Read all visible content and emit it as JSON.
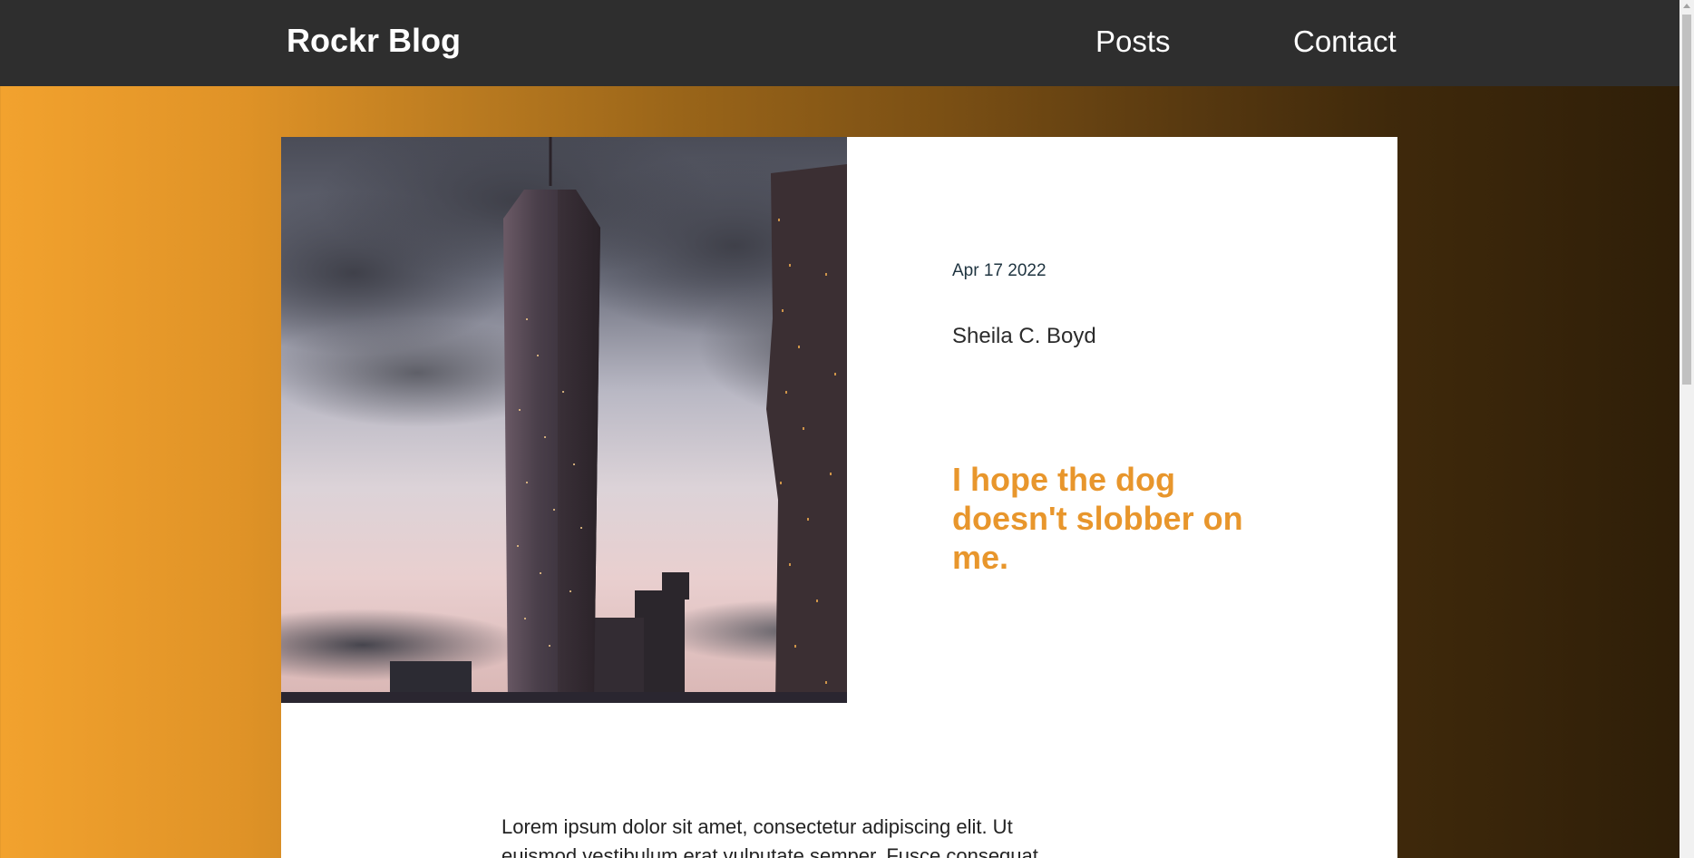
{
  "nav": {
    "brand": "Rockr Blog",
    "links": [
      "Posts",
      "Contact"
    ]
  },
  "post": {
    "image_alt": "skyscraper-at-dusk-photo",
    "date": "Apr 17 2022",
    "author": "Sheila C. Boyd",
    "title": "I hope the dog doesn't slobber on me.",
    "body": "Lorem ipsum dolor sit amet, consectetur adipiscing elit. Ut euismod vestibulum erat vulputate semper. Fusce consequat"
  },
  "colors": {
    "navbar_bg": "#2e2e2e",
    "accent": "#e8962c",
    "gradient_start": "#f2a22e",
    "gradient_end": "#2e1e08"
  }
}
